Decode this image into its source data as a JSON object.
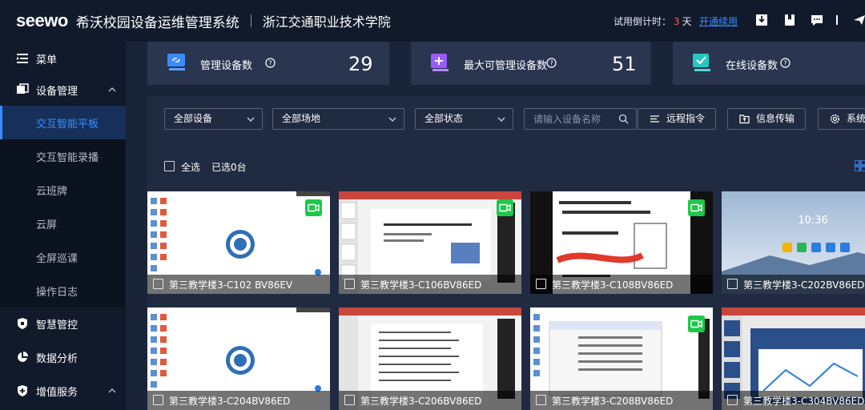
{
  "header": {
    "logo": "seewo",
    "app_title": "希沃校园设备运维管理系统",
    "school": "浙江交通职业技术学院",
    "trial_prefix": "试用倒计时：",
    "trial_days": "3",
    "trial_unit": "天",
    "renew_link": "开通续用",
    "icons": [
      "download-icon",
      "bookmark-icon",
      "message-icon",
      "menu-icon",
      "send-icon"
    ]
  },
  "sidebar": {
    "menu": "菜单",
    "device_mgmt": "设备管理",
    "sub_items": [
      "交互智能平板",
      "交互智能录播",
      "云班牌",
      "云屏",
      "全屏巡课",
      "操作日志"
    ],
    "active_sub": "交互智能平板",
    "smart_ctrl": "智慧管控",
    "data_analysis": "数据分析",
    "value_added": "增值服务"
  },
  "stats": [
    {
      "label": "管理设备数",
      "value": "29",
      "icon": "device-link-icon",
      "color": "#3b8cff"
    },
    {
      "label": "最大可管理设备数",
      "value": "51",
      "icon": "add-device-icon",
      "color": "#9b5cff"
    },
    {
      "label": "在线设备数",
      "value": "",
      "icon": "online-check-icon",
      "color": "#28c7c2"
    }
  ],
  "filters": {
    "device": "全部设备",
    "venue": "全部场地",
    "status": "全部状态",
    "search_placeholder": "请输入设备名称",
    "remote_cmd": "远程指令",
    "info_transfer": "信息传输",
    "system": "系统"
  },
  "selection": {
    "select_all": "全选",
    "selected": "已选0台"
  },
  "devices": [
    {
      "name": "第三教学楼3-C102 BV86EV",
      "camera": true,
      "screen": "desktop"
    },
    {
      "name": "第三教学楼3-C106BV86ED",
      "camera": true,
      "screen": "slides"
    },
    {
      "name": "第三教学楼3-C108BV86ED",
      "camera": true,
      "screen": "document"
    },
    {
      "name": "第三教学楼3-C202BV86ED",
      "camera": false,
      "screen": "home"
    },
    {
      "name": "第三教学楼3-C204BV86ED",
      "camera": false,
      "screen": "desktop"
    },
    {
      "name": "第三教学楼3-C206BV86ED",
      "camera": false,
      "screen": "slides2"
    },
    {
      "name": "第三教学楼3-C208BV86ED",
      "camera": true,
      "screen": "explorer"
    },
    {
      "name": "第三教学楼3-C304BV86ED",
      "camera": false,
      "screen": "slides3"
    }
  ],
  "home_clock": "10:36"
}
